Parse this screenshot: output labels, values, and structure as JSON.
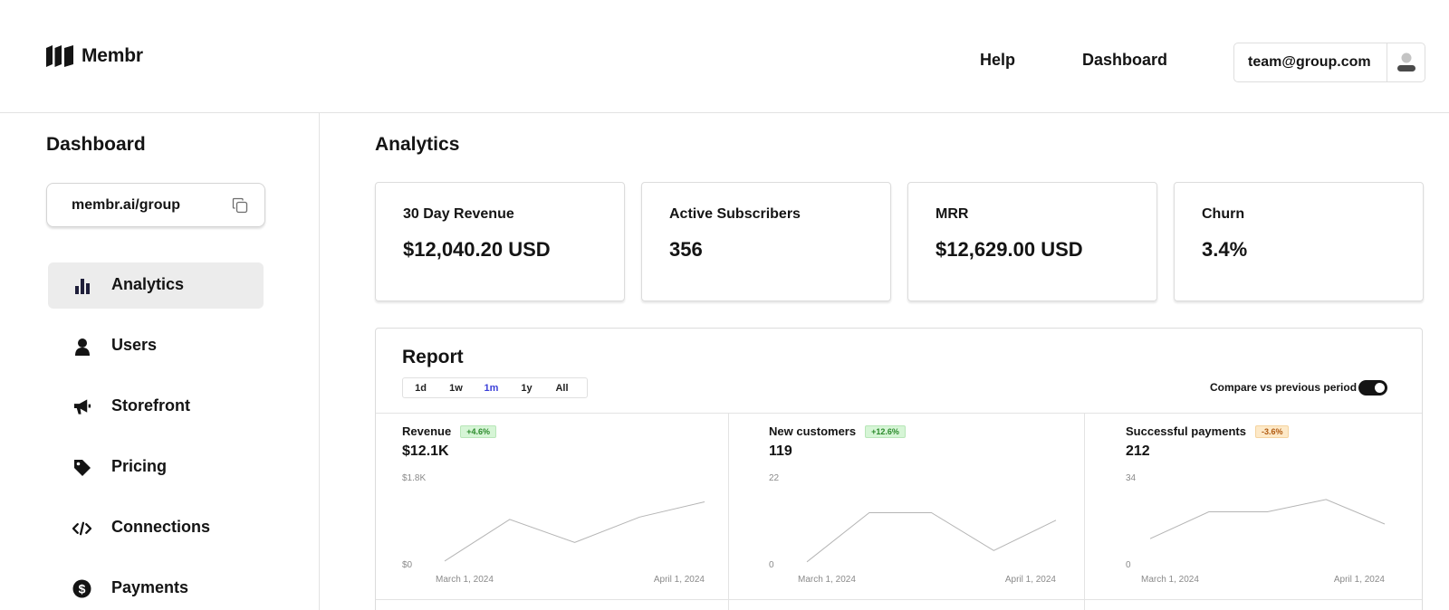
{
  "header": {
    "brand": "Membr",
    "nav": {
      "help": "Help",
      "dashboard": "Dashboard"
    },
    "account_email": "team@group.com"
  },
  "sidebar": {
    "title": "Dashboard",
    "url": "membr.ai/group",
    "items": [
      {
        "label": "Analytics",
        "icon": "bar-chart-icon",
        "active": true
      },
      {
        "label": "Users",
        "icon": "user-icon"
      },
      {
        "label": "Storefront",
        "icon": "megaphone-icon"
      },
      {
        "label": "Pricing",
        "icon": "tag-icon"
      },
      {
        "label": "Connections",
        "icon": "code-icon"
      },
      {
        "label": "Payments",
        "icon": "dollar-icon"
      }
    ]
  },
  "main": {
    "title": "Analytics",
    "stats": [
      {
        "label": "30 Day Revenue",
        "value": "$12,040.20 USD"
      },
      {
        "label": "Active Subscribers",
        "value": "356"
      },
      {
        "label": "MRR",
        "value": "$12,629.00 USD"
      },
      {
        "label": "Churn",
        "value": "3.4%"
      }
    ],
    "report": {
      "title": "Report",
      "periods": [
        "1d",
        "1w",
        "1m",
        "1y",
        "All"
      ],
      "active_period": "1m",
      "compare_label": "Compare vs previous period",
      "compare_enabled": true
    }
  },
  "chart_data": [
    {
      "type": "line",
      "title": "Revenue",
      "value": "$12.1K",
      "change": "+4.6%",
      "trend": "up",
      "x_labels": [
        "March 1, 2024",
        "April 1, 2024"
      ],
      "y_labels": [
        "$1.8K",
        "$0"
      ],
      "ylim": [
        0,
        1800
      ],
      "values": [
        100,
        1000,
        500,
        1050,
        1380
      ]
    },
    {
      "type": "line",
      "title": "New customers",
      "value": "119",
      "change": "+12.6%",
      "trend": "up",
      "x_labels": [
        "March 1, 2024",
        "April 1, 2024"
      ],
      "y_labels": [
        "22",
        "0"
      ],
      "ylim": [
        0,
        22
      ],
      "values": [
        1,
        14,
        14,
        4,
        12
      ]
    },
    {
      "type": "line",
      "title": "Successful payments",
      "value": "212",
      "change": "-3.6%",
      "trend": "down",
      "x_labels": [
        "March 1, 2024",
        "April 1, 2024"
      ],
      "y_labels": [
        "34",
        "0"
      ],
      "ylim": [
        0,
        34
      ],
      "values": [
        11,
        22,
        22,
        27,
        17
      ]
    }
  ]
}
